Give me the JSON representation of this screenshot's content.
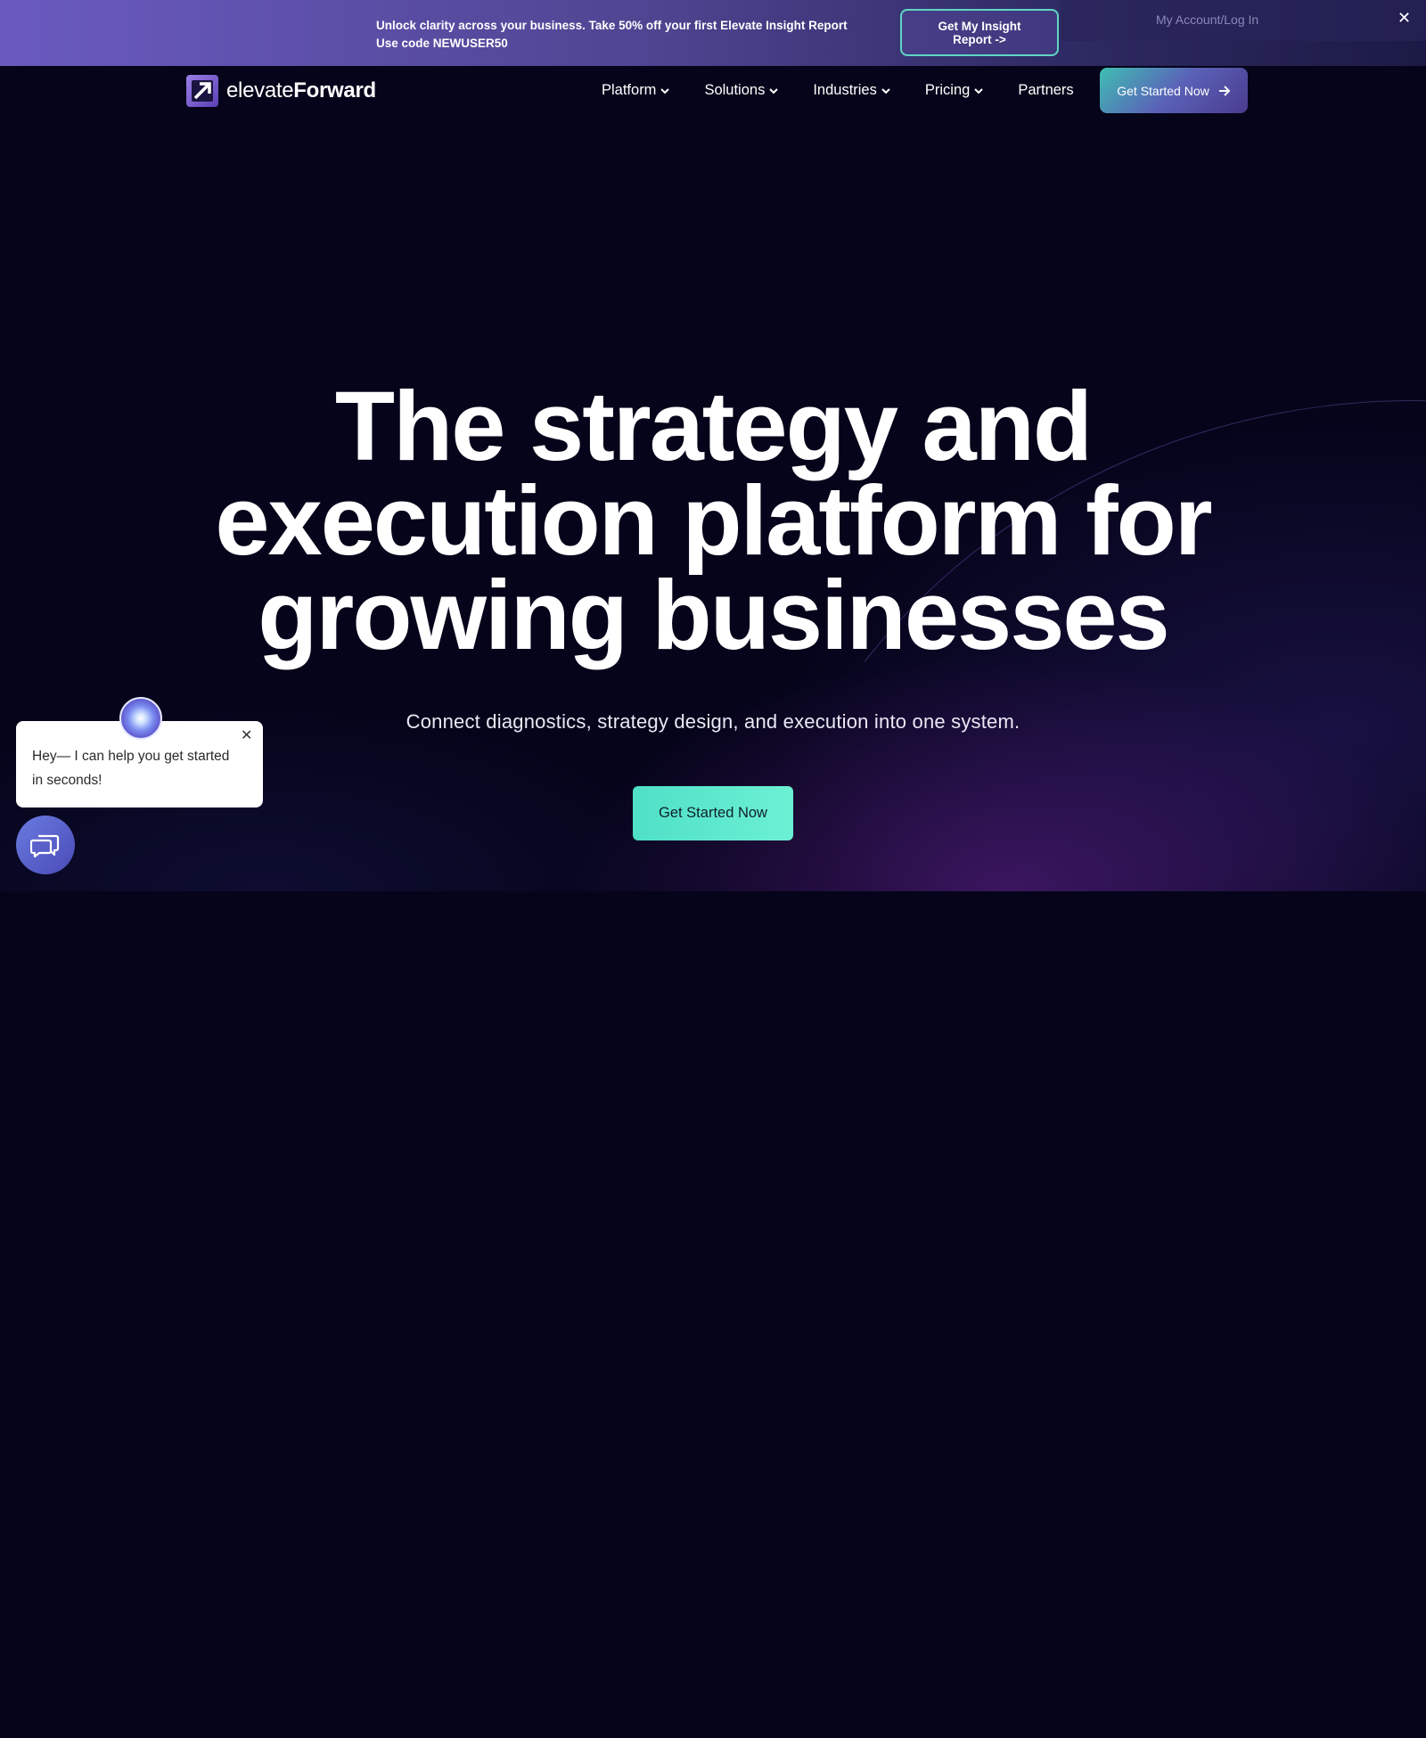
{
  "promo": {
    "line1": "Unlock clarity across your business. Take 50% off your first Elevate Insight Report",
    "line2": "Use code NEWUSER50",
    "button_label": "Get My Insight Report ->",
    "account_link": "My Account/Log In",
    "close": "✕"
  },
  "header": {
    "logo_text_light": "elevate",
    "logo_text_bold": "Forward",
    "nav": [
      {
        "label": "Platform",
        "dropdown": true
      },
      {
        "label": "Solutions",
        "dropdown": true
      },
      {
        "label": "Industries",
        "dropdown": true
      },
      {
        "label": "Pricing",
        "dropdown": true
      },
      {
        "label": "Partners",
        "dropdown": false
      }
    ],
    "cta_label": "Get Started Now"
  },
  "hero": {
    "title_line1": "The strategy and",
    "title_line2": "execution platform for",
    "title_line3": "growing businesses",
    "subtitle": "Connect diagnostics, strategy design, and execution into one system.",
    "cta_label": "Get Started Now"
  },
  "chat": {
    "message": "Hey— I can help you get started in seconds!",
    "close": "✕"
  },
  "colors": {
    "background": "#05041a",
    "accent_teal": "#4fe0c7",
    "promo_purple": "#6a5ac0"
  }
}
